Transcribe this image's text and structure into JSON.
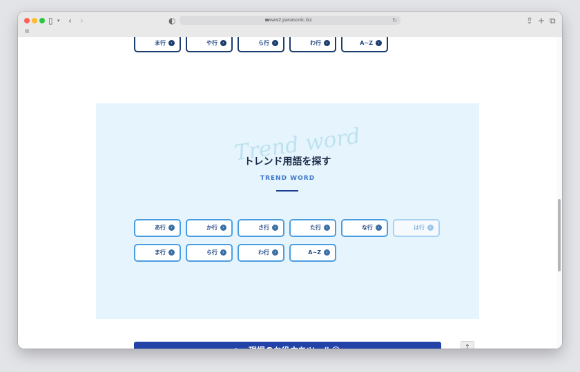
{
  "browser": {
    "url": "www2.panasonic.biz"
  },
  "top_kana_row": [
    "ま行",
    "や行",
    "ら行",
    "わ行",
    "A~Z"
  ],
  "trend": {
    "script_word": "Trend word",
    "title": "トレンド用語を探す",
    "subtitle": "TREND WORD",
    "row1": [
      "あ行",
      "か行",
      "さ行",
      "た行",
      "な行",
      "は行"
    ],
    "row2": [
      "ま行",
      "ら行",
      "わ行",
      "A~Z"
    ]
  },
  "tools": {
    "label": "現場のお役立ちツール",
    "icon": "tools-icon"
  },
  "colors": {
    "accent_blue": "#2342a8",
    "section_bg": "#e6f4fd",
    "button_border": "#4a9ee0"
  }
}
